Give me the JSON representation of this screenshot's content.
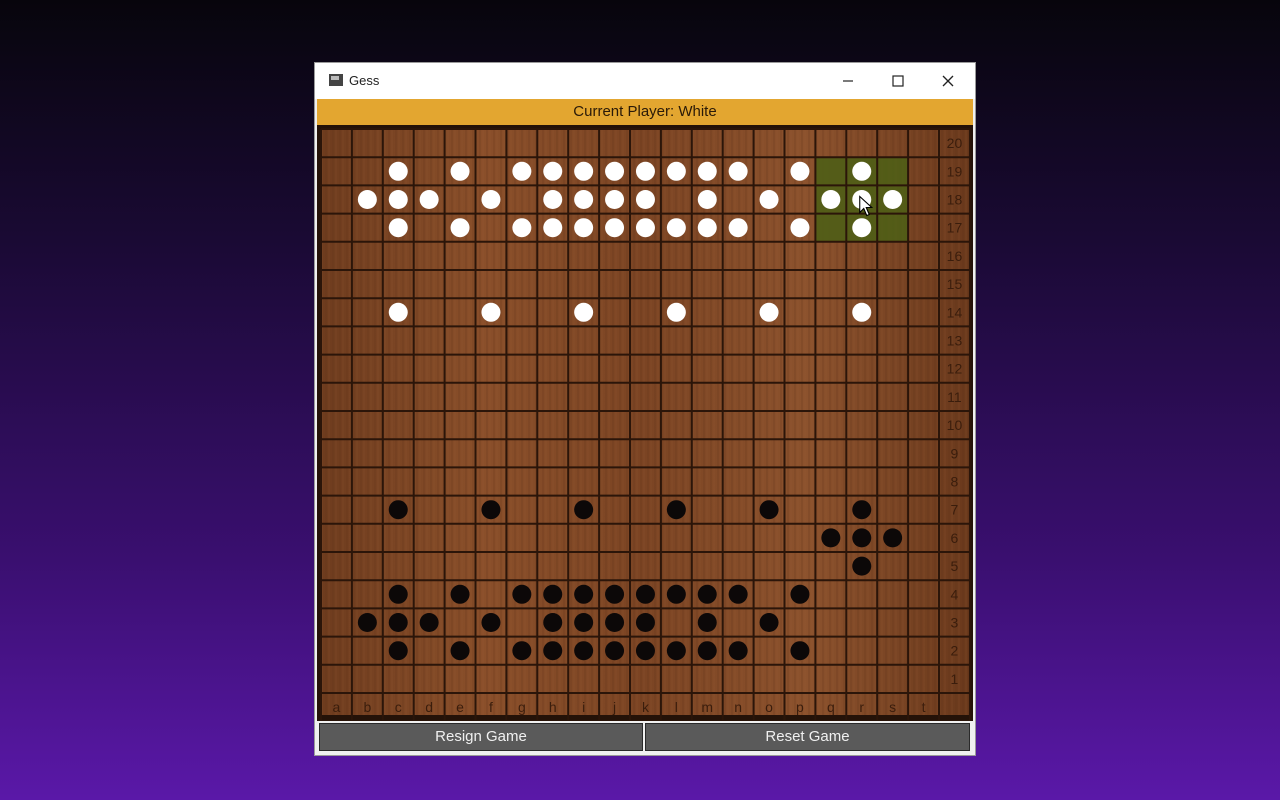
{
  "window": {
    "title": "Gess"
  },
  "status": {
    "text": "Current Player: White"
  },
  "board": {
    "columns": [
      "a",
      "b",
      "c",
      "d",
      "e",
      "f",
      "g",
      "h",
      "i",
      "j",
      "k",
      "l",
      "m",
      "n",
      "o",
      "p",
      "q",
      "r",
      "s",
      "t"
    ],
    "rows": [
      20,
      19,
      18,
      17,
      16,
      15,
      14,
      13,
      12,
      11,
      10,
      9,
      8,
      7,
      6,
      5,
      4,
      3,
      2,
      1
    ],
    "highlight": {
      "col_from": "q",
      "col_to": "s",
      "row_from": 17,
      "row_to": 19,
      "color": "#4f5e16"
    },
    "white_stones": [
      "c19",
      "e19",
      "g19",
      "h19",
      "i19",
      "j19",
      "k19",
      "l19",
      "m19",
      "n19",
      "p19",
      "r19",
      "b18",
      "c18",
      "d18",
      "f18",
      "h18",
      "i18",
      "j18",
      "k18",
      "m18",
      "o18",
      "q18",
      "r18",
      "s18",
      "c17",
      "e17",
      "g17",
      "h17",
      "i17",
      "j17",
      "k17",
      "l17",
      "m17",
      "n17",
      "p17",
      "r17",
      "c14",
      "f14",
      "i14",
      "l14",
      "o14",
      "r14"
    ],
    "black_stones": [
      "c7",
      "f7",
      "i7",
      "l7",
      "o7",
      "r7",
      "q6",
      "r6",
      "s6",
      "r5",
      "c4",
      "e4",
      "g4",
      "h4",
      "i4",
      "j4",
      "k4",
      "l4",
      "m4",
      "n4",
      "p4",
      "b3",
      "c3",
      "d3",
      "f3",
      "h3",
      "i3",
      "j3",
      "k3",
      "m3",
      "o3",
      "c2",
      "e2",
      "g2",
      "h2",
      "i2",
      "j2",
      "k2",
      "l2",
      "m2",
      "n2",
      "p2"
    ],
    "cursor_at": "r18"
  },
  "buttons": {
    "resign": "Resign Game",
    "reset": "Reset Game"
  },
  "colors": {
    "status_bar": "#e3a630",
    "wood": "#7a4424",
    "grid": "#2b1509",
    "white_stone": "#ffffff",
    "black_stone": "#0c0808"
  }
}
